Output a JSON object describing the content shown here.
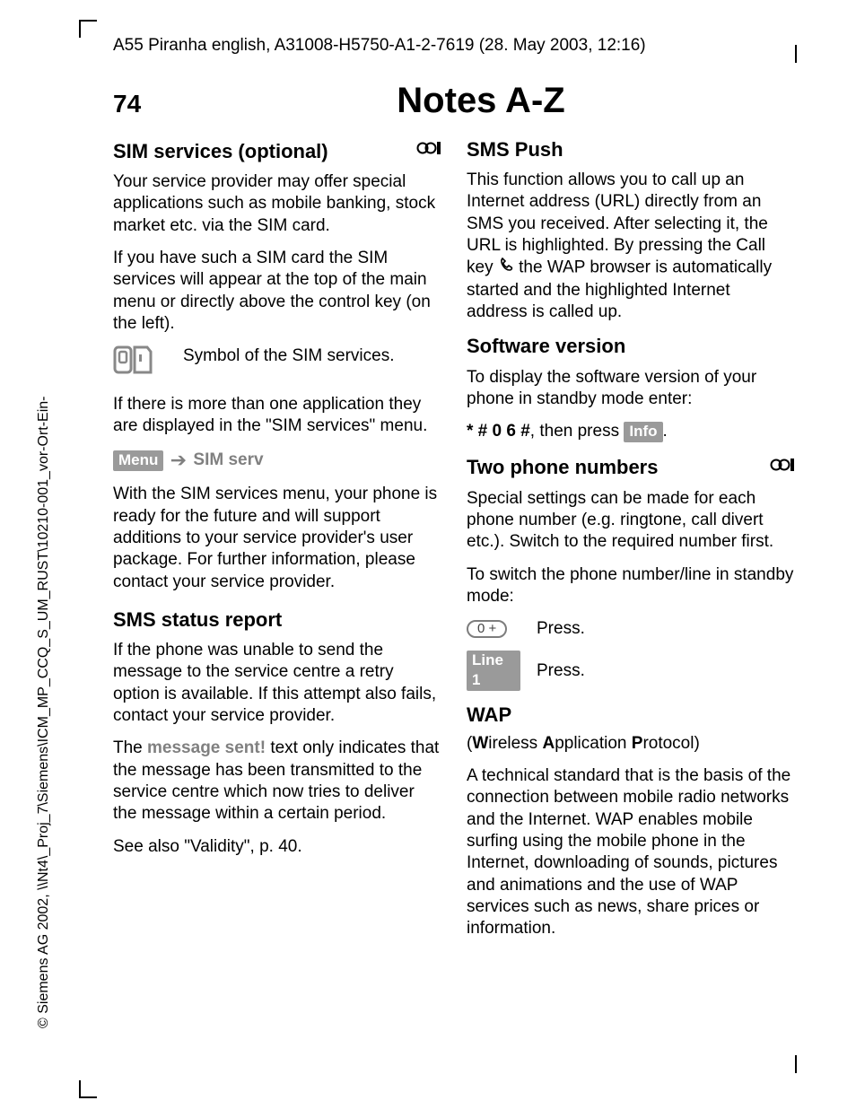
{
  "header": "A55 Piranha english, A31008-H5750-A1-2-7619 (28. May 2003, 12:16)",
  "side": "© Siemens AG 2002, \\\\Nt4\\_Proj_7\\Siemens\\ICM_MP_CCQ_S_UM_RUST\\10210-001_vor-Ort-Ein-",
  "pageNumber": "74",
  "pageTitle": "Notes A-Z",
  "left": {
    "simServices": {
      "heading": "SIM services (optional)",
      "p1": "Your service provider may offer special applications such as mobile banking, stock market etc. via the SIM card.",
      "p2": "If you have such a SIM card the SIM services will appear at the top of the main menu or directly above the control key (on the left).",
      "iconCaption": "Symbol of the SIM services.",
      "p3": "If there is more than one application they are displayed in the \"SIM services\" menu.",
      "menuLabel": "Menu",
      "menuTarget": "SIM serv",
      "p4": "With the SIM services menu, your phone is ready for the future and will support additions to your service provider's user package. For further information, please contact your service provider."
    },
    "smsStatus": {
      "heading": "SMS status report",
      "p1": "If the phone was unable to send the message to the service centre a retry option is available. If this attempt also fails, contact your service provider.",
      "p2a": "The ",
      "p2grey": "message sent!",
      "p2b": " text only indicates that the message has been transmitted to the service centre which now tries to deliver the message within a certain period.",
      "p3": "See also \"Validity\", p. 40."
    }
  },
  "right": {
    "smsPush": {
      "heading": "SMS Push",
      "p1a": "This function allows you to call up an Internet address (URL) directly from an SMS you received. After selecting it, the URL is highlighted. By pressing the Call key ",
      "p1b": " the WAP browser is automatically started and the highlighted Internet address is called up."
    },
    "software": {
      "heading": "Software version",
      "p1": "To display the software version of your phone in standby mode enter:",
      "codePrefix": "*",
      "code": " # 0 6 #",
      "codeSuffix": ", then press ",
      "infoLabel": "Info",
      "codeEnd": "."
    },
    "twoNumbers": {
      "heading": "Two phone numbers",
      "p1": "Special settings can be made for each phone number (e.g. ringtone, call divert etc.). Switch to the required number first.",
      "p2": "To switch the phone number/line in standby mode:",
      "keyLabel": "0 +",
      "press1": "Press.",
      "line1Label": "Line 1",
      "press2": "Press."
    },
    "wap": {
      "heading": "WAP",
      "sub": "(Wireless Application Protocol)",
      "subParts": {
        "open": "(",
        "w": "W",
        "w2": "ireless ",
        "a": "A",
        "a2": "pplication ",
        "p": "P",
        "p2": "rotocol)"
      },
      "p1": "A technical standard that is the basis of the connection between mobile radio networks and the Internet. WAP enables mobile surfing using the mobile phone in the Internet, downloading of sounds, pictures and animations and the use of WAP services such as news, share prices or information."
    }
  }
}
